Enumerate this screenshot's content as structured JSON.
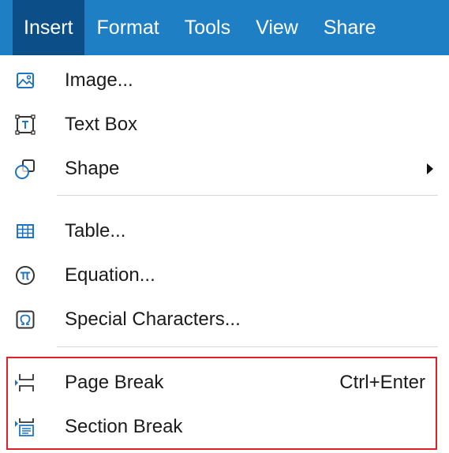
{
  "menubar": {
    "tabs": [
      {
        "label": "Insert",
        "active": true
      },
      {
        "label": "Format"
      },
      {
        "label": "Tools"
      },
      {
        "label": "View"
      },
      {
        "label": "Share"
      }
    ]
  },
  "menu": {
    "items": [
      {
        "label": "Image...",
        "icon": "image-icon"
      },
      {
        "label": "Text Box",
        "icon": "text-box-icon"
      },
      {
        "label": "Shape",
        "icon": "shape-icon",
        "submenu": true
      },
      {
        "label": "Table...",
        "icon": "table-icon"
      },
      {
        "label": "Equation...",
        "icon": "pi-icon"
      },
      {
        "label": "Special Characters...",
        "icon": "omega-icon"
      },
      {
        "label": "Page Break",
        "icon": "page-break-icon",
        "shortcut": "Ctrl+Enter"
      },
      {
        "label": "Section Break",
        "icon": "section-break-icon"
      }
    ]
  },
  "colors": {
    "menubar_bg": "#1f7fc4",
    "active_tab_bg": "#0b4e88",
    "highlight_border": "#e0212c"
  }
}
